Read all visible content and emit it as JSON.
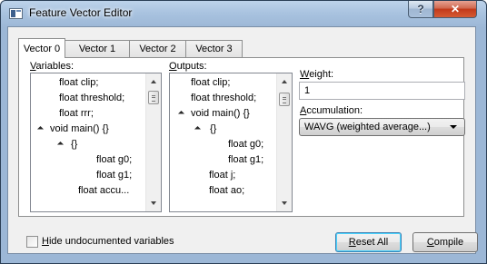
{
  "window": {
    "title": "Feature Vector Editor",
    "help_label": "?",
    "close_label": "✕"
  },
  "tabs": [
    {
      "label": "Vector 0",
      "active": true
    },
    {
      "label": "Vector 1",
      "active": false
    },
    {
      "label": "Vector 2",
      "active": false
    },
    {
      "label": "Vector 3",
      "active": false
    }
  ],
  "variables": {
    "label_accel": "V",
    "label_rest": "ariables:",
    "items": [
      {
        "text": "float clip;",
        "expander": false
      },
      {
        "text": "float threshold;",
        "expander": false
      },
      {
        "text": "float rrr;",
        "expander": false
      },
      {
        "text": "void main() {}",
        "expander": true
      },
      {
        "text": "{}",
        "expander": true
      },
      {
        "text": "float g0;",
        "expander": false
      },
      {
        "text": "float g1;",
        "expander": false
      },
      {
        "text": "float accu...",
        "expander": false
      }
    ]
  },
  "outputs": {
    "label_accel": "O",
    "label_rest": "utputs:",
    "items": [
      {
        "text": "float clip;",
        "expander": false
      },
      {
        "text": "float threshold;",
        "expander": false
      },
      {
        "text": "void main() {}",
        "expander": true
      },
      {
        "text": "{}",
        "expander": true
      },
      {
        "text": "float g0;",
        "expander": false
      },
      {
        "text": "float g1;",
        "expander": false
      },
      {
        "text": "float j;",
        "expander": false
      },
      {
        "text": "float ao;",
        "expander": false
      }
    ]
  },
  "weight": {
    "label_accel": "W",
    "label_rest": "eight:",
    "value": "1"
  },
  "accumulation": {
    "label_accel": "A",
    "label_rest": "ccumulation:",
    "selected": "WAVG (weighted average...)"
  },
  "hide_undocumented": {
    "label_accel": "H",
    "label_rest": "ide undocumented variables",
    "checked": false
  },
  "buttons": {
    "reset_accel": "R",
    "reset_rest": "eset All",
    "compile_accel": "C",
    "compile_rest": "ompile"
  }
}
